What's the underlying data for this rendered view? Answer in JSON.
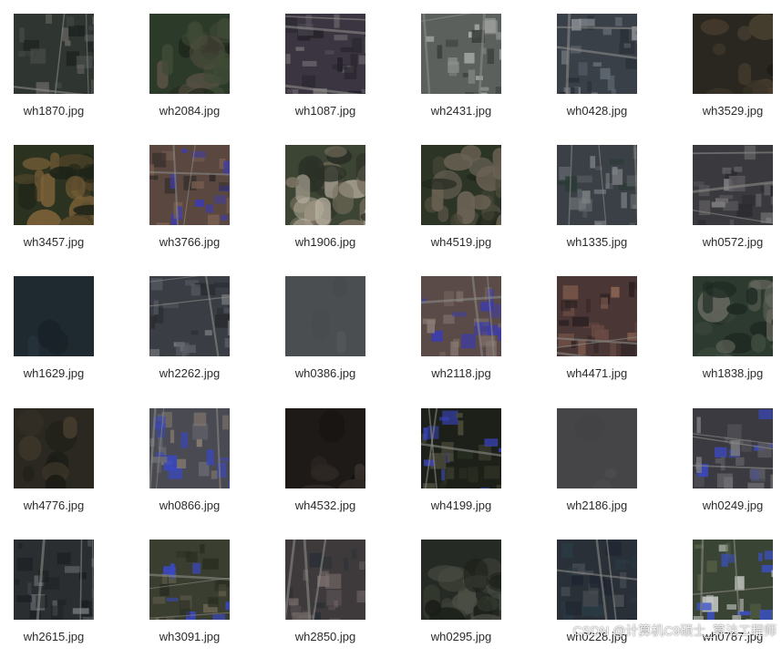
{
  "files": [
    {
      "name": "wh1870.jpg",
      "palette": [
        "#2f3530",
        "#4a4f4b",
        "#6b6a66",
        "#1e2320"
      ],
      "pattern": "urban"
    },
    {
      "name": "wh2084.jpg",
      "palette": [
        "#2c3a2a",
        "#3f4a35",
        "#5a5244",
        "#1f271c"
      ],
      "pattern": "forest"
    },
    {
      "name": "wh1087.jpg",
      "palette": [
        "#3a3540",
        "#55505a",
        "#7a7378",
        "#25222a"
      ],
      "pattern": "urban"
    },
    {
      "name": "wh2431.jpg",
      "palette": [
        "#5c605c",
        "#8a8e8c",
        "#3c403e",
        "#a8aba8"
      ],
      "pattern": "industrial"
    },
    {
      "name": "wh0428.jpg",
      "palette": [
        "#3a4048",
        "#616872",
        "#2a3036",
        "#8a8f94"
      ],
      "pattern": "urban"
    },
    {
      "name": "wh3529.jpg",
      "palette": [
        "#2a2620",
        "#3a3428",
        "#1e1c18",
        "#4a4030"
      ],
      "pattern": "dark"
    },
    {
      "name": "wh3457.jpg",
      "palette": [
        "#2b3220",
        "#5a4a2c",
        "#1f2418",
        "#7a6038"
      ],
      "pattern": "forest"
    },
    {
      "name": "wh3766.jpg",
      "palette": [
        "#5a4840",
        "#7a5e50",
        "#3d3bb0",
        "#2e2a28"
      ],
      "pattern": "blueroof"
    },
    {
      "name": "wh1906.jpg",
      "palette": [
        "#3c4434",
        "#7a7060",
        "#b8b0a0",
        "#2a3026"
      ],
      "pattern": "forest"
    },
    {
      "name": "wh4519.jpg",
      "palette": [
        "#2c3426",
        "#4a4a3a",
        "#6a6254",
        "#1e241a"
      ],
      "pattern": "forest"
    },
    {
      "name": "wh1335.jpg",
      "palette": [
        "#3a4046",
        "#5c6066",
        "#2a3a34",
        "#7a7e82"
      ],
      "pattern": "urban"
    },
    {
      "name": "wh0572.jpg",
      "palette": [
        "#3a3a3e",
        "#5c5a5e",
        "#2a2a2e",
        "#7c7a7c"
      ],
      "pattern": "urban"
    },
    {
      "name": "wh1629.jpg",
      "palette": [
        "#1f2a30",
        "#26323a",
        "#1a2228",
        "#2e3a40"
      ],
      "pattern": "water"
    },
    {
      "name": "wh2262.jpg",
      "palette": [
        "#3a3e44",
        "#5a5e64",
        "#2a2c30",
        "#7a7e82"
      ],
      "pattern": "urban"
    },
    {
      "name": "wh0386.jpg",
      "palette": [
        "#4a4e50",
        "#52585a",
        "#464a4c",
        "#5a6062"
      ],
      "pattern": "water"
    },
    {
      "name": "wh2118.jpg",
      "palette": [
        "#5a4a48",
        "#7a6a64",
        "#3a3cb0",
        "#8a7a74"
      ],
      "pattern": "blueroof"
    },
    {
      "name": "wh4471.jpg",
      "palette": [
        "#4a3634",
        "#6a4a44",
        "#2e2224",
        "#8a6454"
      ],
      "pattern": "urban"
    },
    {
      "name": "wh1838.jpg",
      "palette": [
        "#2c3a30",
        "#3e4a3e",
        "#6a6a60",
        "#1e2a22"
      ],
      "pattern": "forest"
    },
    {
      "name": "wh4776.jpg",
      "palette": [
        "#2a2820",
        "#3a3428",
        "#1c1c16",
        "#4a4030"
      ],
      "pattern": "dark"
    },
    {
      "name": "wh0866.jpg",
      "palette": [
        "#4a4a52",
        "#6a6a72",
        "#3a48c0",
        "#8a7e70"
      ],
      "pattern": "blueroof"
    },
    {
      "name": "wh4532.jpg",
      "palette": [
        "#1e1a18",
        "#2e2824",
        "#3e3630",
        "#141210"
      ],
      "pattern": "dark"
    },
    {
      "name": "wh4199.jpg",
      "palette": [
        "#1c2018",
        "#2c3024",
        "#3a44c0",
        "#4a4a3a"
      ],
      "pattern": "blueroof"
    },
    {
      "name": "wh2186.jpg",
      "palette": [
        "#454446",
        "#4b4a4c",
        "#424143",
        "#4e4d4f"
      ],
      "pattern": "water"
    },
    {
      "name": "wh0249.jpg",
      "palette": [
        "#3a3a40",
        "#5a5a60",
        "#3a48c0",
        "#7a7a7e"
      ],
      "pattern": "blueroof"
    },
    {
      "name": "wh2615.jpg",
      "palette": [
        "#2a2e30",
        "#4a4e52",
        "#1c2022",
        "#6a6e72"
      ],
      "pattern": "urban"
    },
    {
      "name": "wh3091.jpg",
      "palette": [
        "#3a3e30",
        "#6a6450",
        "#3a48c0",
        "#2a2e22"
      ],
      "pattern": "blueroof"
    },
    {
      "name": "wh2850.jpg",
      "palette": [
        "#3e3a3c",
        "#5e5658",
        "#2a3036",
        "#7a6e6c"
      ],
      "pattern": "urban"
    },
    {
      "name": "wh0295.jpg",
      "palette": [
        "#262a24",
        "#3a3e34",
        "#1a1e18",
        "#4a4e44"
      ],
      "pattern": "forest"
    },
    {
      "name": "wh0228.jpg",
      "palette": [
        "#2a3038",
        "#1e2430",
        "#4a4e54",
        "#2a3a44"
      ],
      "pattern": "urban"
    },
    {
      "name": "wh0787.jpg",
      "palette": [
        "#3a4434",
        "#5a6448",
        "#3a50c8",
        "#c8ccc8"
      ],
      "pattern": "blueroof"
    }
  ],
  "watermark": "CSDN @计算机C9硕士_算法工程师"
}
